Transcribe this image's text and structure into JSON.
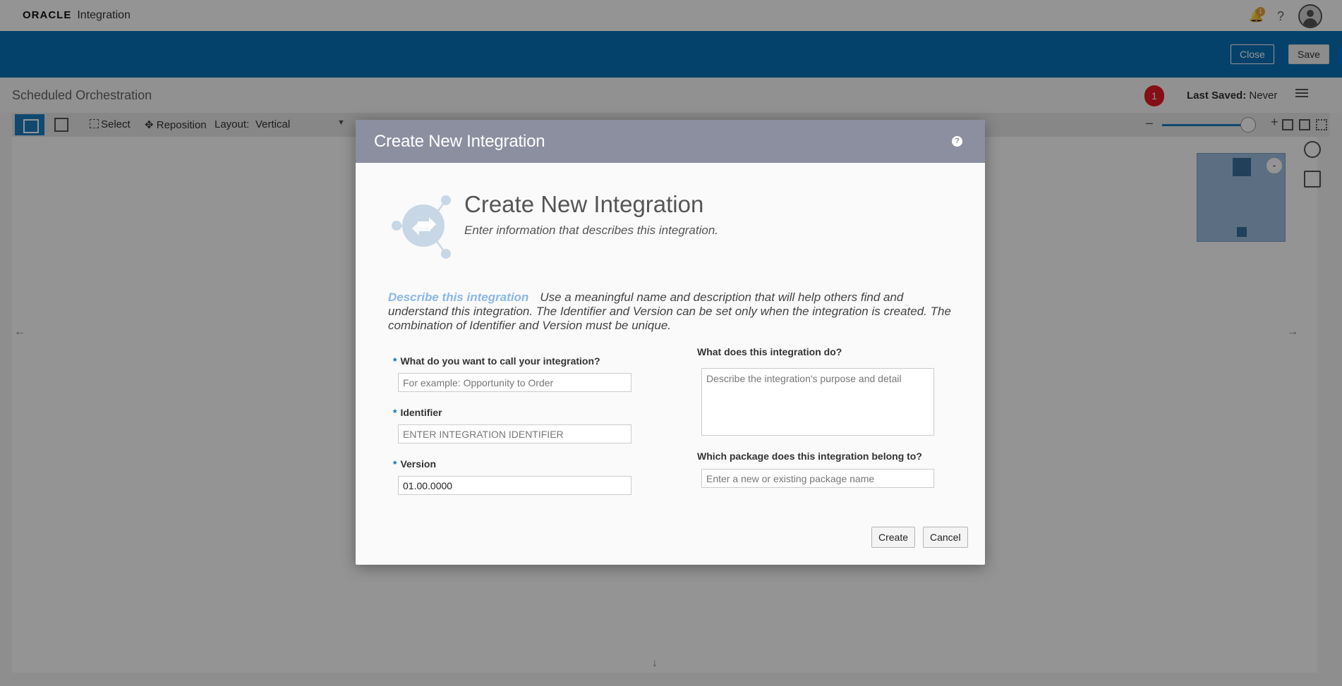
{
  "app": {
    "brand": "ORACLE",
    "product": "Integration",
    "notification_count": "1",
    "help_glyph": "?"
  },
  "actionbar": {
    "close_label": "Close",
    "save_label": "Save"
  },
  "page": {
    "title": "Scheduled Orchestration",
    "error_count": "1",
    "last_saved_label": "Last Saved:",
    "last_saved_value": "Never"
  },
  "toolbar": {
    "select_label": "Select",
    "reposition_label": "Reposition",
    "layout_label": "Layout:",
    "layout_value": "Vertical",
    "zoom_level": 0.9
  },
  "overview": {
    "minimize_label": "-"
  },
  "dialog": {
    "header_title": "Create New Integration",
    "help_glyph": "?",
    "hero_title": "Create New Integration",
    "hero_subtitle": "Enter information that describes this integration.",
    "describe_label": "Describe this integration",
    "describe_text": "Use a meaningful name and description that will help others find and understand this integration. The Identifier and Version can be set only when the integration is created. The combination of Identifier and Version must be unique.",
    "required_mark": "*",
    "name_label": "What do you want to call your integration?",
    "name_placeholder": "For example: Opportunity to Order",
    "identifier_label": "Identifier",
    "identifier_placeholder": "ENTER INTEGRATION IDENTIFIER",
    "version_label": "Version",
    "version_value": "01.00.0000",
    "description_label": "What does this integration do?",
    "description_placeholder": "Describe the integration's purpose and detail",
    "package_label": "Which package does this integration belong to?",
    "package_placeholder": "Enter a new or existing package name",
    "create_label": "Create",
    "cancel_label": "Cancel"
  },
  "colors": {
    "brand_blue": "#0a72b8",
    "dialog_header": "#8c8f9f",
    "error_red": "#e31b23",
    "describe_accent": "#8ab8e6"
  }
}
